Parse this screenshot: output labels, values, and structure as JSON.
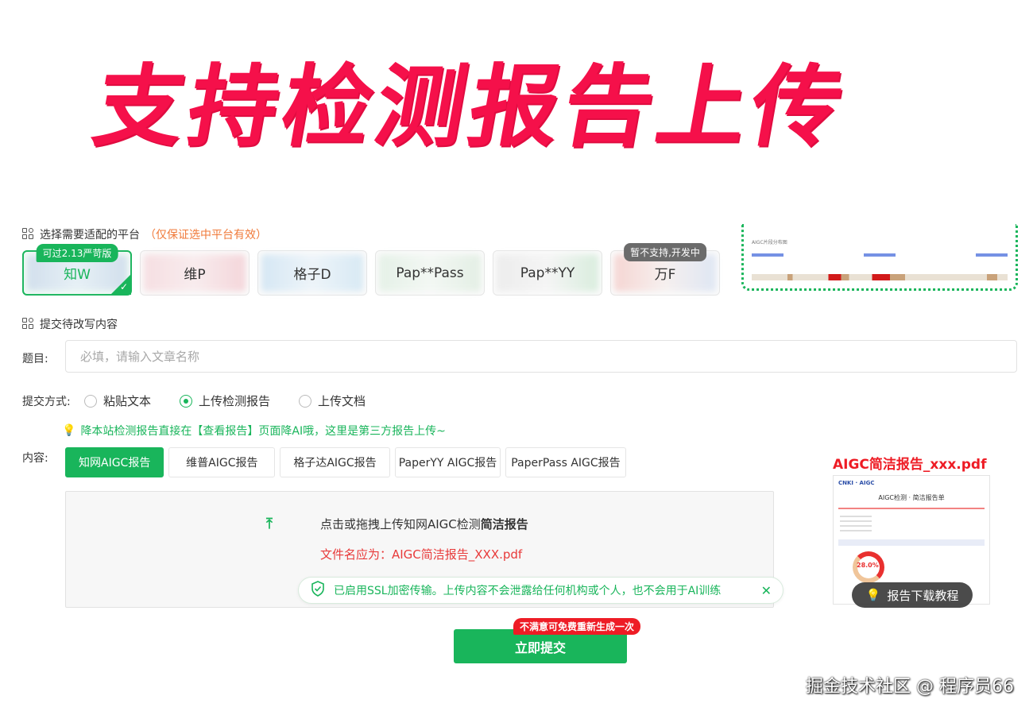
{
  "headline": "支持检测报告上传",
  "platform_section": {
    "title": "选择需要适配的平台",
    "hint": "（仅保证选中平台有效）",
    "platforms": [
      {
        "label": "知W",
        "tag": "可过2.13严苛版",
        "selected": true
      },
      {
        "label": "维P",
        "tag": "",
        "selected": false
      },
      {
        "label": "格子D",
        "tag": "",
        "selected": false
      },
      {
        "label": "Pap**Pass",
        "tag": "",
        "selected": false
      },
      {
        "label": "Pap**YY",
        "tag": "",
        "selected": false
      },
      {
        "label": "万F",
        "tag": "暂不支持,开发中",
        "selected": false
      }
    ]
  },
  "content_section": {
    "title": "提交待改写内容",
    "title_label": "题目:",
    "title_placeholder": "必填，请输入文章名称",
    "method_label": "提交方式:",
    "methods": [
      {
        "label": "粘贴文本",
        "selected": false
      },
      {
        "label": "上传检测报告",
        "selected": true
      },
      {
        "label": "上传文档",
        "selected": false
      }
    ],
    "notice": "降本站检测报告直接在【查看报告】页面降AI哦，这里是第三方报告上传~",
    "content_label": "内容:",
    "report_tabs": [
      {
        "label": "知网AIGC报告",
        "active": true
      },
      {
        "label": "维普AIGC报告",
        "active": false
      },
      {
        "label": "格子达AIGC报告",
        "active": false
      },
      {
        "label": "PaperYY AIGC报告",
        "active": false
      },
      {
        "label": "PaperPass AIGC报告",
        "active": false
      }
    ],
    "upload_prompt": "点击或拖拽上传知网AIGC检测",
    "upload_prompt_bold": "简洁报告",
    "filename_hint": "文件名应为：AIGC简洁报告_XXX.pdf",
    "ssl_notice": "已启用SSL加密传输。上传内容不会泄露给任何机构或个人，也不会用于AI训练",
    "submit_label": "立即提交",
    "promo": "不满意可免费重新生成一次"
  },
  "sample": {
    "title": "AIGC简洁报告_xxx.pdf",
    "doc_title": "AIGC检测 · 简洁报告单",
    "ring_value": "28.0%",
    "tutorial_label": "报告下载教程"
  },
  "preview": {
    "heading": "AIGC片段分布图"
  },
  "watermark": "掘金技术社区 @ 程序员66",
  "colors": {
    "accent": "#19b55b",
    "headline": "#f5104a",
    "warning": "#e83a3a"
  }
}
